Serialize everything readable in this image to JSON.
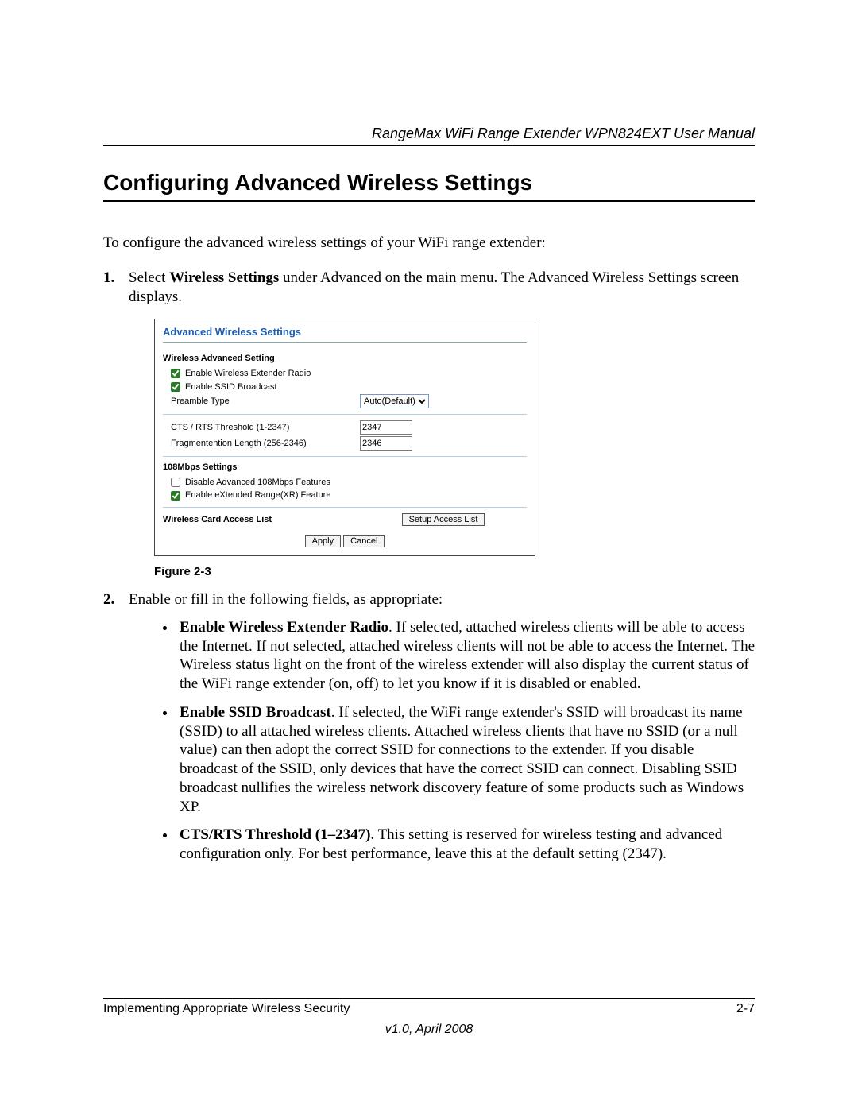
{
  "header": {
    "doc_title": "RangeMax WiFi Range Extender WPN824EXT User Manual"
  },
  "heading": "Configuring Advanced Wireless Settings",
  "intro": "To configure the advanced wireless settings of your WiFi range extender:",
  "steps": {
    "s1_pre": "Select ",
    "s1_bold": "Wireless Settings",
    "s1_post": " under Advanced on the main menu. The Advanced Wireless Settings screen displays.",
    "s2": "Enable or fill in the following fields, as appropriate:"
  },
  "panel": {
    "title": "Advanced Wireless Settings",
    "section_adv": "Wireless Advanced Setting",
    "cb_radio_label": "Enable Wireless Extender Radio",
    "cb_radio_checked": true,
    "cb_ssid_label": "Enable SSID Broadcast",
    "cb_ssid_checked": true,
    "preamble_label": "Preamble Type",
    "preamble_value": "Auto(Default)",
    "cts_label": "CTS / RTS Threshold (1-2347)",
    "cts_value": "2347",
    "frag_label": "Fragmentention Length (256-2346)",
    "frag_value": "2346",
    "section_108": "108Mbps Settings",
    "cb_disable108_label": "Disable Advanced 108Mbps Features",
    "cb_disable108_checked": false,
    "cb_xr_label": "Enable eXtended Range(XR) Feature",
    "cb_xr_checked": true,
    "section_card": "Wireless Card Access List",
    "btn_setup": "Setup Access List",
    "btn_apply": "Apply",
    "btn_cancel": "Cancel"
  },
  "figure_caption": "Figure 2-3",
  "bullets": {
    "b1_bold": "Enable Wireless Extender Radio",
    "b1_body": ". If selected, attached wireless clients will be able to access the Internet. If not selected, attached wireless clients will not be able to access the Internet. The Wireless status light on the front of the wireless extender will also display the current status of the WiFi range extender (on, off) to let you know if it is disabled or enabled.",
    "b2_bold": "Enable SSID Broadcast",
    "b2_body": ". If selected, the WiFi range extender's SSID will broadcast its name (SSID) to all attached wireless clients. Attached wireless clients that have no SSID (or a null value) can then adopt the correct SSID for connections to the extender. If you disable broadcast of the SSID, only devices that have the correct SSID can connect. Disabling SSID broadcast nullifies the wireless network discovery feature of some products such as Windows XP.",
    "b3_bold": "CTS/RTS Threshold (1–2347)",
    "b3_body": ". This setting is reserved for wireless testing and advanced configuration only. For best performance, leave this at the default setting (2347)."
  },
  "footer": {
    "chapter": "Implementing Appropriate Wireless Security",
    "page": "2-7",
    "version": "v1.0, April 2008"
  }
}
